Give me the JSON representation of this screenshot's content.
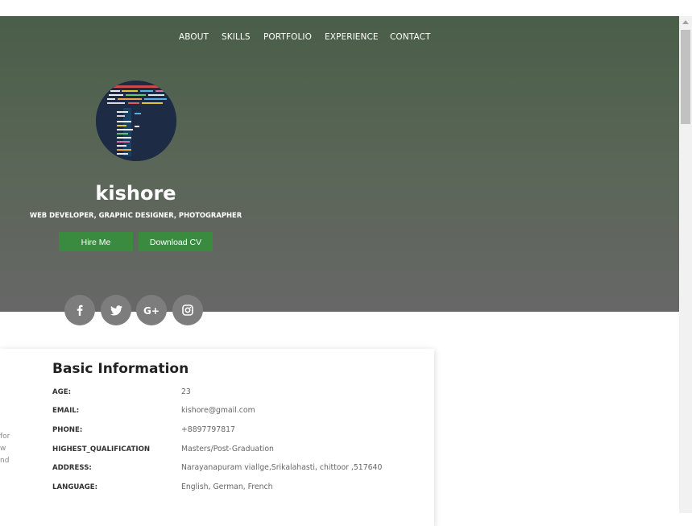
{
  "nav": {
    "items": [
      {
        "label": "ABOUT"
      },
      {
        "label": "SKILLS"
      },
      {
        "label": "PORTFOLIO"
      },
      {
        "label": "EXPERIENCE"
      },
      {
        "label": "CONTACT"
      }
    ]
  },
  "profile": {
    "name": "kishore",
    "subtitle": "WEB DEVELOPER, GRAPHIC DESIGNER, PHOTOGRAPHER",
    "hire_label": "Hire Me",
    "download_label": "Download CV"
  },
  "social": {
    "facebook": "facebook-icon",
    "twitter": "twitter-icon",
    "google_plus": "google-plus-icon",
    "instagram": "instagram-icon"
  },
  "basic_info": {
    "title": "Basic Information",
    "rows": [
      {
        "label": "AGE:",
        "value": "23"
      },
      {
        "label": "EMAIL:",
        "value": "kishore@gmail.com"
      },
      {
        "label": "PHONE:",
        "value": "+8897797817"
      },
      {
        "label": "HIGHEST_QUALIFICATION",
        "value": "Masters/Post-Graduation"
      },
      {
        "label": "ADDRESS:",
        "value": "Narayanapuram viallge,Srikalahasti, chittoor ,517640"
      },
      {
        "label": "LANGUAGE:",
        "value": "English, German, French"
      }
    ]
  },
  "about_fragment": {
    "lines": [
      "for",
      "w",
      "nd"
    ]
  },
  "colors": {
    "hero_top": "#4a5e49",
    "hero_bottom": "#676767",
    "button": "#3a8b3f",
    "social_bg": "#7d7d7d"
  }
}
